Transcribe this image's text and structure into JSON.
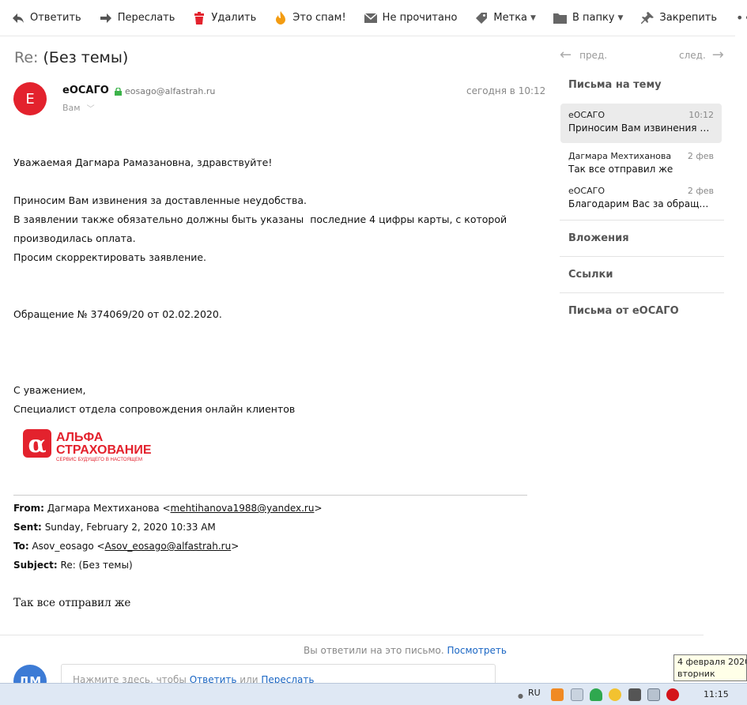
{
  "toolbar": {
    "reply": "Ответить",
    "forward": "Переслать",
    "delete": "Удалить",
    "spam": "Это спам!",
    "unread": "Не прочитано",
    "label": "Метка",
    "folder": "В папку",
    "pin": "Закрепить",
    "more": "•••"
  },
  "message": {
    "subject_prefix": "Re:",
    "subject": "(Без темы)",
    "avatar_letter": "E",
    "sender_name": "еОСАГО",
    "sender_email": "eosago@alfastrah.ru",
    "recipient": "Вам",
    "date": "сегодня в 10:12",
    "greeting": "Уважаемая Дагмара Рамазановна, здравствуйте!",
    "line1": "Приносим Вам извинения за доставленные неудобства.",
    "line2": "В заявлении также обязательно должны быть указаны  последние 4 цифры карты, с которой",
    "line3": "производилась оплата.",
    "line4": "Просим скорректировать заявление.",
    "case": "Обращение № 374069/20 от 02.02.2020.",
    "regards": "С уважением,",
    "signature": "Специалист отдела сопровождения онлайн клиентов",
    "logo_line1": "АЛЬФА",
    "logo_line2": "СТРАХОВАНИЕ",
    "logo_tagline": "СЕРВИС БУДУЩЕГО В НАСТОЯЩЕМ",
    "logo_symbol": "α",
    "logo_color": "#e3222d"
  },
  "quoted": {
    "from_label": "From:",
    "from_name": "Дагмара Мехтиханова <",
    "from_email": "mehtihanova1988@yandex.ru",
    "from_close": ">",
    "sent_label": "Sent:",
    "sent_value": "Sunday, February 2, 2020 10:33 AM",
    "to_label": "To:",
    "to_name": "Asov_eosago <",
    "to_email": "Asov_eosago@alfastrah.ru",
    "to_close": ">",
    "subject_label": "Subject:",
    "subject_value": "Re: (Без темы)",
    "body": "Так все отправил же"
  },
  "footer": {
    "replied_text": "Вы ответили на это письмо.",
    "replied_link": "Посмотреть",
    "avatar2": "ДМ",
    "reply_hint_pre": "Нажмите здесь, чтобы ",
    "reply_link": "Ответить",
    "reply_hint_mid": " или ",
    "forward_link": "Переслать"
  },
  "panel": {
    "prev": "пред.",
    "next": "след.",
    "thread_title": "Письма на тему",
    "threads": [
      {
        "from": "еОСАГО",
        "date": "10:12",
        "preview": "Приносим Вам извинения за доставленные неудобства."
      },
      {
        "from": "Дагмара Мехтиханова",
        "date": "2 фев",
        "preview": "Так все отправил же"
      },
      {
        "from": "еОСАГО",
        "date": "2 фев",
        "preview": "Благодарим Вас за обращение"
      }
    ],
    "attachments": "Вложения",
    "links": "Ссылки",
    "from_sender": "Письма от еОСАГО"
  },
  "tooltip": {
    "line1": "4 февраля 2020 г.",
    "line2": "вторник"
  },
  "taskbar": {
    "lang": "RU",
    "clock": "11:15"
  }
}
